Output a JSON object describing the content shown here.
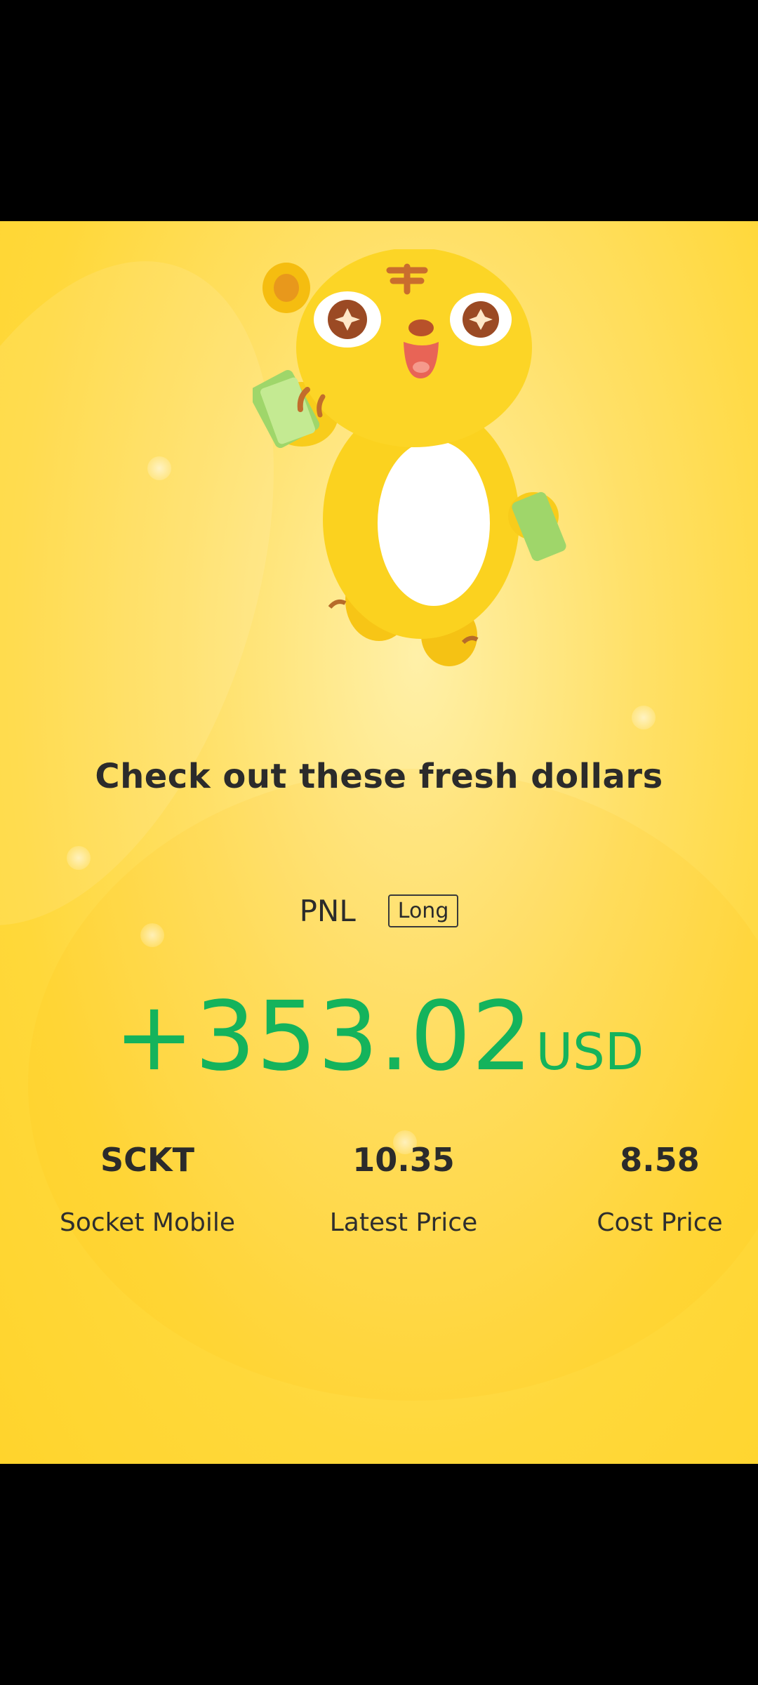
{
  "colors": {
    "background": "#ffd83a",
    "profit_green": "#14b35c",
    "text_dark": "#2b2b2b"
  },
  "mascot": {
    "icon": "tiger-mascot-with-money-icon"
  },
  "headline": "Check out these fresh dollars",
  "pnl": {
    "label": "PNL",
    "position_tag": "Long",
    "amount": "+353.02",
    "currency": "USD"
  },
  "stats": [
    {
      "value": "SCKT",
      "label": "Socket Mobile"
    },
    {
      "value": "10.35",
      "label": "Latest Price"
    },
    {
      "value": "8.58",
      "label": "Cost Price"
    }
  ]
}
